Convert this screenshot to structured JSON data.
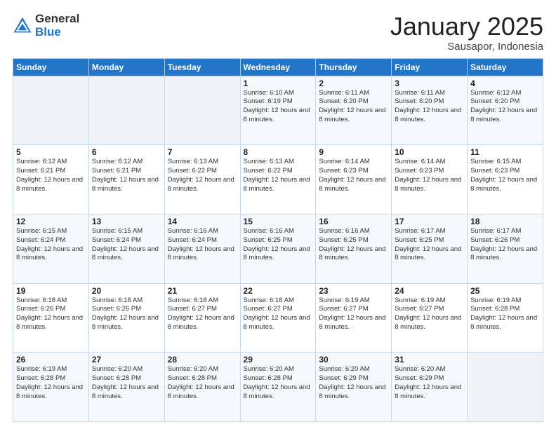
{
  "logo": {
    "general": "General",
    "blue": "Blue"
  },
  "header": {
    "month": "January 2025",
    "location": "Sausapor, Indonesia"
  },
  "weekdays": [
    "Sunday",
    "Monday",
    "Tuesday",
    "Wednesday",
    "Thursday",
    "Friday",
    "Saturday"
  ],
  "weeks": [
    [
      {
        "day": "",
        "info": ""
      },
      {
        "day": "",
        "info": ""
      },
      {
        "day": "",
        "info": ""
      },
      {
        "day": "1",
        "info": "Sunrise: 6:10 AM\nSunset: 6:19 PM\nDaylight: 12 hours and 8 minutes."
      },
      {
        "day": "2",
        "info": "Sunrise: 6:11 AM\nSunset: 6:20 PM\nDaylight: 12 hours and 8 minutes."
      },
      {
        "day": "3",
        "info": "Sunrise: 6:11 AM\nSunset: 6:20 PM\nDaylight: 12 hours and 8 minutes."
      },
      {
        "day": "4",
        "info": "Sunrise: 6:12 AM\nSunset: 6:20 PM\nDaylight: 12 hours and 8 minutes."
      }
    ],
    [
      {
        "day": "5",
        "info": "Sunrise: 6:12 AM\nSunset: 6:21 PM\nDaylight: 12 hours and 8 minutes."
      },
      {
        "day": "6",
        "info": "Sunrise: 6:12 AM\nSunset: 6:21 PM\nDaylight: 12 hours and 8 minutes."
      },
      {
        "day": "7",
        "info": "Sunrise: 6:13 AM\nSunset: 6:22 PM\nDaylight: 12 hours and 8 minutes."
      },
      {
        "day": "8",
        "info": "Sunrise: 6:13 AM\nSunset: 6:22 PM\nDaylight: 12 hours and 8 minutes."
      },
      {
        "day": "9",
        "info": "Sunrise: 6:14 AM\nSunset: 6:23 PM\nDaylight: 12 hours and 8 minutes."
      },
      {
        "day": "10",
        "info": "Sunrise: 6:14 AM\nSunset: 6:23 PM\nDaylight: 12 hours and 8 minutes."
      },
      {
        "day": "11",
        "info": "Sunrise: 6:15 AM\nSunset: 6:23 PM\nDaylight: 12 hours and 8 minutes."
      }
    ],
    [
      {
        "day": "12",
        "info": "Sunrise: 6:15 AM\nSunset: 6:24 PM\nDaylight: 12 hours and 8 minutes."
      },
      {
        "day": "13",
        "info": "Sunrise: 6:15 AM\nSunset: 6:24 PM\nDaylight: 12 hours and 8 minutes."
      },
      {
        "day": "14",
        "info": "Sunrise: 6:16 AM\nSunset: 6:24 PM\nDaylight: 12 hours and 8 minutes."
      },
      {
        "day": "15",
        "info": "Sunrise: 6:16 AM\nSunset: 6:25 PM\nDaylight: 12 hours and 8 minutes."
      },
      {
        "day": "16",
        "info": "Sunrise: 6:16 AM\nSunset: 6:25 PM\nDaylight: 12 hours and 8 minutes."
      },
      {
        "day": "17",
        "info": "Sunrise: 6:17 AM\nSunset: 6:25 PM\nDaylight: 12 hours and 8 minutes."
      },
      {
        "day": "18",
        "info": "Sunrise: 6:17 AM\nSunset: 6:26 PM\nDaylight: 12 hours and 8 minutes."
      }
    ],
    [
      {
        "day": "19",
        "info": "Sunrise: 6:18 AM\nSunset: 6:26 PM\nDaylight: 12 hours and 8 minutes."
      },
      {
        "day": "20",
        "info": "Sunrise: 6:18 AM\nSunset: 6:26 PM\nDaylight: 12 hours and 8 minutes."
      },
      {
        "day": "21",
        "info": "Sunrise: 6:18 AM\nSunset: 6:27 PM\nDaylight: 12 hours and 8 minutes."
      },
      {
        "day": "22",
        "info": "Sunrise: 6:18 AM\nSunset: 6:27 PM\nDaylight: 12 hours and 8 minutes."
      },
      {
        "day": "23",
        "info": "Sunrise: 6:19 AM\nSunset: 6:27 PM\nDaylight: 12 hours and 8 minutes."
      },
      {
        "day": "24",
        "info": "Sunrise: 6:19 AM\nSunset: 6:27 PM\nDaylight: 12 hours and 8 minutes."
      },
      {
        "day": "25",
        "info": "Sunrise: 6:19 AM\nSunset: 6:28 PM\nDaylight: 12 hours and 8 minutes."
      }
    ],
    [
      {
        "day": "26",
        "info": "Sunrise: 6:19 AM\nSunset: 6:28 PM\nDaylight: 12 hours and 8 minutes."
      },
      {
        "day": "27",
        "info": "Sunrise: 6:20 AM\nSunset: 6:28 PM\nDaylight: 12 hours and 8 minutes."
      },
      {
        "day": "28",
        "info": "Sunrise: 6:20 AM\nSunset: 6:28 PM\nDaylight: 12 hours and 8 minutes."
      },
      {
        "day": "29",
        "info": "Sunrise: 6:20 AM\nSunset: 6:28 PM\nDaylight: 12 hours and 8 minutes."
      },
      {
        "day": "30",
        "info": "Sunrise: 6:20 AM\nSunset: 6:29 PM\nDaylight: 12 hours and 8 minutes."
      },
      {
        "day": "31",
        "info": "Sunrise: 6:20 AM\nSunset: 6:29 PM\nDaylight: 12 hours and 8 minutes."
      },
      {
        "day": "",
        "info": ""
      }
    ]
  ]
}
